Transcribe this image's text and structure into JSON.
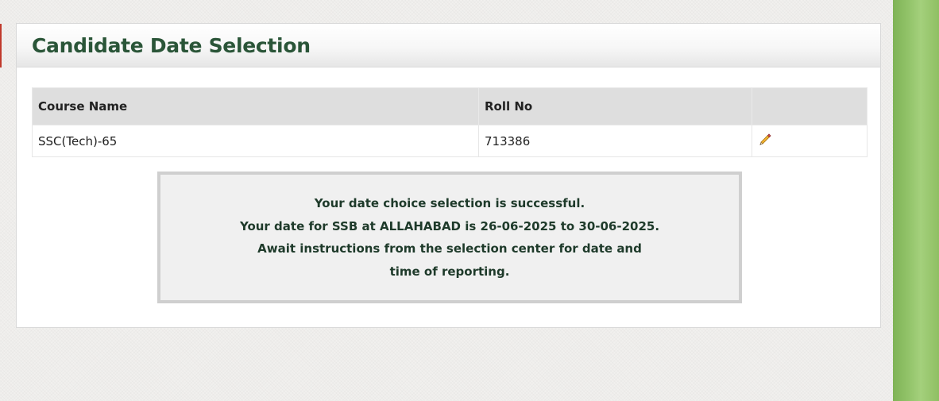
{
  "page": {
    "title": "Candidate Date Selection"
  },
  "table": {
    "headers": {
      "course_name": "Course Name",
      "roll_no": "Roll No",
      "action": ""
    },
    "rows": [
      {
        "course_name": "SSC(Tech)-65",
        "roll_no": "713386",
        "action_icon": "edit-pencil-icon"
      }
    ]
  },
  "message": {
    "line1": "Your date choice selection is successful.",
    "line2": "Your date for SSB at ALLAHABAD is 26-06-2025 to 30-06-2025.",
    "line3": "Await instructions from the selection center for date and time of reporting."
  },
  "colors": {
    "title": "#2a5538",
    "message_text": "#1e3a2a",
    "side_strip": "#93c46a",
    "left_accent": "#c0392b"
  }
}
